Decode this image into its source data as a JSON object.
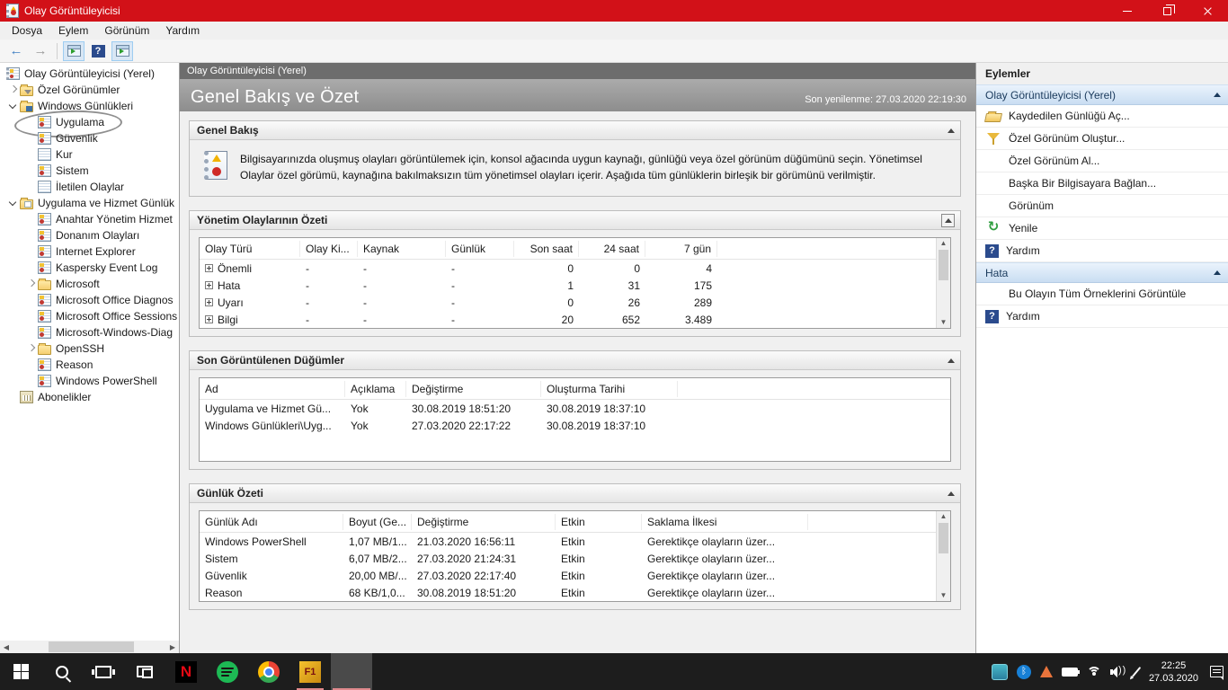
{
  "window": {
    "title": "Olay Görüntüleyicisi",
    "colors": {
      "titlebar": "#d21118",
      "taskbar": "#1d1d1d",
      "accent_underline": "#e08a8d",
      "action_header": "#c9ddf2"
    }
  },
  "menu": {
    "items": [
      {
        "label": "Dosya"
      },
      {
        "label": "Eylem"
      },
      {
        "label": "Görünüm"
      },
      {
        "label": "Yardım"
      }
    ]
  },
  "toolbar": {
    "icons": [
      "back-arrow",
      "forward-arrow",
      "show-console-tree",
      "help",
      "show-action-pane"
    ]
  },
  "tree": {
    "items": [
      {
        "label": "Olay Görüntüleyicisi (Yerel)",
        "cls": "ind0",
        "exp": "none0",
        "icon": "icoroot"
      },
      {
        "label": "Özel Görünümler",
        "cls": "ind1",
        "exp": "right",
        "icon": "icofoldf"
      },
      {
        "label": "Windows Günlükleri",
        "cls": "ind1",
        "exp": "down",
        "icon": "icofoldc"
      },
      {
        "label": "Uygulama",
        "cls": "ind2 circled",
        "exp": "blank",
        "icon": "icolog"
      },
      {
        "label": "Güvenlik",
        "cls": "ind2",
        "exp": "blank",
        "icon": "icolog"
      },
      {
        "label": "Kur",
        "cls": "ind2",
        "exp": "blank",
        "icon": "icolog2"
      },
      {
        "label": "Sistem",
        "cls": "ind2",
        "exp": "blank",
        "icon": "icolog"
      },
      {
        "label": "İletilen Olaylar",
        "cls": "ind2",
        "exp": "blank",
        "icon": "icolog2"
      },
      {
        "label": "Uygulama ve Hizmet Günlük",
        "cls": "ind1",
        "exp": "down",
        "icon": "icofold2"
      },
      {
        "label": "Anahtar Yönetim Hizmet",
        "cls": "ind2",
        "exp": "blank",
        "icon": "icolog"
      },
      {
        "label": "Donanım Olayları",
        "cls": "ind2",
        "exp": "blank",
        "icon": "icolog"
      },
      {
        "label": "Internet Explorer",
        "cls": "ind2",
        "exp": "blank",
        "icon": "icolog"
      },
      {
        "label": "Kaspersky Event Log",
        "cls": "ind2",
        "exp": "blank",
        "icon": "icolog"
      },
      {
        "label": "Microsoft",
        "cls": "ind2",
        "exp": "right",
        "icon": "icofolder"
      },
      {
        "label": "Microsoft Office Diagnos",
        "cls": "ind2",
        "exp": "blank",
        "icon": "icolog"
      },
      {
        "label": "Microsoft Office Sessions",
        "cls": "ind2",
        "exp": "blank",
        "icon": "icolog"
      },
      {
        "label": "Microsoft-Windows-Diag",
        "cls": "ind2",
        "exp": "blank",
        "icon": "icolog"
      },
      {
        "label": "OpenSSH",
        "cls": "ind2",
        "exp": "right",
        "icon": "icofolder"
      },
      {
        "label": "Reason",
        "cls": "ind2",
        "exp": "blank",
        "icon": "icolog"
      },
      {
        "label": "Windows PowerShell",
        "cls": "ind2",
        "exp": "blank",
        "icon": "icolog"
      },
      {
        "label": "Abonelikler",
        "cls": "ind1",
        "exp": "blank",
        "icon": "icosub"
      }
    ]
  },
  "main": {
    "breadcrumb": "Olay Görüntüleyicisi (Yerel)",
    "page_title": "Genel Bakış ve Özet",
    "last_refresh": "Son yenilenme: 27.03.2020 22:19:30",
    "overview": {
      "header": "Genel Bakış",
      "body": "Bilgisayarınızda oluşmuş olayları görüntülemek için, konsol ağacında uygun kaynağı, günlüğü veya özel görünüm düğümünü seçin. Yönetimsel Olaylar özel görümü, kaynağına bakılmaksızın tüm yönetimsel olayları içerir. Aşağıda tüm günlüklerin birleşik bir görümünü verilmiştir."
    },
    "summary": {
      "header": "Yönetim Olaylarının Özeti",
      "columns": {
        "c1": "Olay Türü",
        "c2": "Olay Ki...",
        "c3": "Kaynak",
        "c4": "Günlük",
        "c5": "Son saat",
        "c6": "24 saat",
        "c7": "7 gün"
      },
      "rows": [
        {
          "type": "Önemli",
          "kimlik": "-",
          "kaynak": "-",
          "gunluk": "-",
          "son_saat": "0",
          "saat24": "0",
          "gun7": "4"
        },
        {
          "type": "Hata",
          "kimlik": "-",
          "kaynak": "-",
          "gunluk": "-",
          "son_saat": "1",
          "saat24": "31",
          "gun7": "175"
        },
        {
          "type": "Uyarı",
          "kimlik": "-",
          "kaynak": "-",
          "gunluk": "-",
          "son_saat": "0",
          "saat24": "26",
          "gun7": "289"
        },
        {
          "type": "Bilgi",
          "kimlik": "-",
          "kaynak": "-",
          "gunluk": "-",
          "son_saat": "20",
          "saat24": "652",
          "gun7": "3.489"
        }
      ]
    },
    "nodes": {
      "header": "Son Görüntülenen Düğümler",
      "columns": {
        "c1": "Ad",
        "c2": "Açıklama",
        "c3": "Değiştirme",
        "c4": "Oluşturma Tarihi"
      },
      "rows": [
        {
          "ad": "Uygulama ve Hizmet Gü...",
          "aciklama": "Yok",
          "degistirme": "30.08.2019 18:51:20",
          "olusturma": "30.08.2019 18:37:10"
        },
        {
          "ad": "Windows Günlükleri\\Uyg...",
          "aciklama": "Yok",
          "degistirme": "27.03.2020 22:17:22",
          "olusturma": "30.08.2019 18:37:10"
        }
      ]
    },
    "logs": {
      "header": "Günlük Özeti",
      "columns": {
        "c1": "Günlük Adı",
        "c2": "Boyut (Ge...",
        "c3": "Değiştirme",
        "c4": "Etkin",
        "c5": "Saklama İlkesi"
      },
      "rows": [
        {
          "ad": "Windows PowerShell",
          "boyut": "1,07 MB/1...",
          "degistirme": "21.03.2020 16:56:11",
          "etkin": "Etkin",
          "saklama": "Gerektikçe olayların üzer..."
        },
        {
          "ad": "Sistem",
          "boyut": "6,07 MB/2...",
          "degistirme": "27.03.2020 21:24:31",
          "etkin": "Etkin",
          "saklama": "Gerektikçe olayların üzer..."
        },
        {
          "ad": "Güvenlik",
          "boyut": "20,00 MB/...",
          "degistirme": "27.03.2020 22:17:40",
          "etkin": "Etkin",
          "saklama": "Gerektikçe olayların üzer..."
        },
        {
          "ad": "Reason",
          "boyut": "68 KB/1,0...",
          "degistirme": "30.08.2019 18:51:20",
          "etkin": "Etkin",
          "saklama": "Gerektikçe olayların üzer..."
        }
      ]
    }
  },
  "actions": {
    "title": "Eylemler",
    "group1": {
      "header": "Olay Görüntüleyicisi (Yerel)",
      "items": [
        {
          "label": "Kaydedilen Günlüğü Aç...",
          "icon": "aic-open",
          "glyph": ""
        },
        {
          "label": "Özel Görünüm Oluştur...",
          "icon": "aic-filter",
          "glyph": ""
        },
        {
          "label": "Özel Görünüm Al...",
          "icon": "",
          "glyph": ""
        },
        {
          "label": "Başka Bir Bilgisayara Bağlan...",
          "icon": "",
          "glyph": ""
        },
        {
          "label": "Görünüm",
          "icon": "",
          "glyph": "",
          "arrow": "haspop"
        },
        {
          "label": "Yenile",
          "icon": "aic-refresh",
          "glyph": "↻"
        },
        {
          "label": "Yardım",
          "icon": "aic-help",
          "glyph": "?",
          "arrow": "haspop"
        }
      ]
    },
    "group2": {
      "header": "Hata",
      "items": [
        {
          "label": "Bu Olayın Tüm Örneklerini Görüntüle",
          "icon": "",
          "glyph": ""
        },
        {
          "label": "Yardım",
          "icon": "aic-help",
          "glyph": "?"
        }
      ]
    }
  },
  "taskbar": {
    "apps": [
      {
        "name": "start",
        "cls": "tb-start",
        "state": ""
      },
      {
        "name": "search",
        "cls": "tb-search",
        "state": ""
      },
      {
        "name": "task-view",
        "cls": "tb-task",
        "state": ""
      },
      {
        "name": "connect",
        "cls": "tb-connect",
        "state": ""
      },
      {
        "name": "netflix",
        "cls": "tb-netflix",
        "state": "",
        "glyph": "N"
      },
      {
        "name": "spotify",
        "cls": "tb-spotify",
        "state": ""
      },
      {
        "name": "chrome",
        "cls": "tb-chrome",
        "state": ""
      },
      {
        "name": "f1-game",
        "cls": "tb-f1-game",
        "state": "running",
        "glyph": "F1"
      },
      {
        "name": "event-viewer",
        "cls": "tb-event-viewer",
        "state": "active"
      }
    ],
    "tray": [
      {
        "name": "tray-app",
        "cls": "tr-app"
      },
      {
        "name": "bluetooth",
        "cls": "tr-bt",
        "glyph": "ᛒ"
      },
      {
        "name": "vlc",
        "cls": "tr-vlc"
      },
      {
        "name": "battery",
        "cls": "tr-batt"
      },
      {
        "name": "wifi",
        "cls": "tr-wifi"
      },
      {
        "name": "volume",
        "cls": "tr-vol"
      },
      {
        "name": "pen",
        "cls": "tr-pen"
      }
    ],
    "clock": {
      "time": "22:25",
      "date": "27.03.2020"
    }
  }
}
